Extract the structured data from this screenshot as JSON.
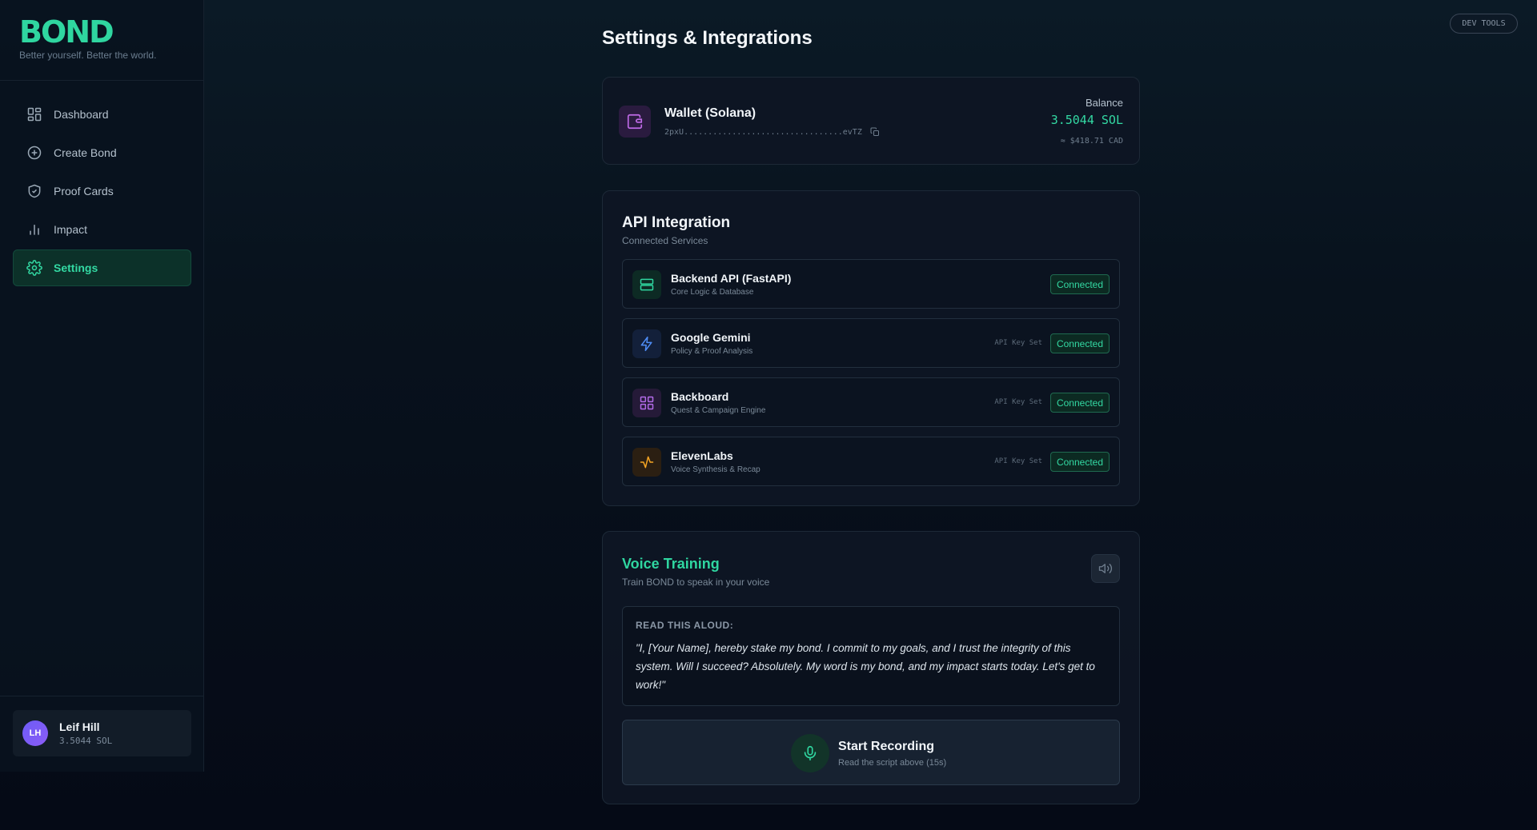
{
  "app": {
    "logo": "BOND",
    "tagline": "Better yourself. Better the world.",
    "dev_tools_label": "DEV TOOLS",
    "accent_color": "#2fd6a0"
  },
  "sidebar": {
    "items": [
      {
        "label": "Dashboard",
        "icon": "dashboard-icon"
      },
      {
        "label": "Create Bond",
        "icon": "plus-circle-icon"
      },
      {
        "label": "Proof Cards",
        "icon": "shield-check-icon"
      },
      {
        "label": "Impact",
        "icon": "bar-chart-icon"
      },
      {
        "label": "Settings",
        "icon": "gear-icon",
        "active": true
      }
    ]
  },
  "user": {
    "initials": "LH",
    "name": "Leif Hill",
    "balance": "3.5044 SOL"
  },
  "page": {
    "title": "Settings & Integrations"
  },
  "wallet": {
    "title": "Wallet (Solana)",
    "address": "2pxU.................................evTZ",
    "balance_label": "Balance",
    "balance_value": "3.5044 SOL",
    "balance_fiat": "≈ $418.71 CAD"
  },
  "api": {
    "title": "API Integration",
    "subtitle": "Connected Services",
    "services": [
      {
        "name": "Backend API (FastAPI)",
        "description": "Core Logic & Database",
        "key_status": "",
        "status": "Connected",
        "icon": "server-icon",
        "color": "#2fd6a0"
      },
      {
        "name": "Google Gemini",
        "description": "Policy & Proof Analysis",
        "key_status": "API Key Set",
        "status": "Connected",
        "icon": "lightning-icon",
        "color": "#4f8ef7"
      },
      {
        "name": "Backboard",
        "description": "Quest & Campaign Engine",
        "key_status": "API Key Set",
        "status": "Connected",
        "icon": "grid-icon",
        "color": "#b26be8"
      },
      {
        "name": "ElevenLabs",
        "description": "Voice Synthesis & Recap",
        "key_status": "API Key Set",
        "status": "Connected",
        "icon": "activity-icon",
        "color": "#f5a524"
      }
    ]
  },
  "voice": {
    "title": "Voice Training",
    "subtitle": "Train BOND to speak in your voice",
    "script_label": "READ THIS ALOUD:",
    "script_text": "\"I, [Your Name], hereby stake my bond. I commit to my goals, and I trust the integrity of this system. Will I succeed? Absolutely. My word is my bond, and my impact starts today. Let's get to work!\"",
    "record_label": "Start Recording",
    "record_sub": "Read the script above (15s)"
  }
}
